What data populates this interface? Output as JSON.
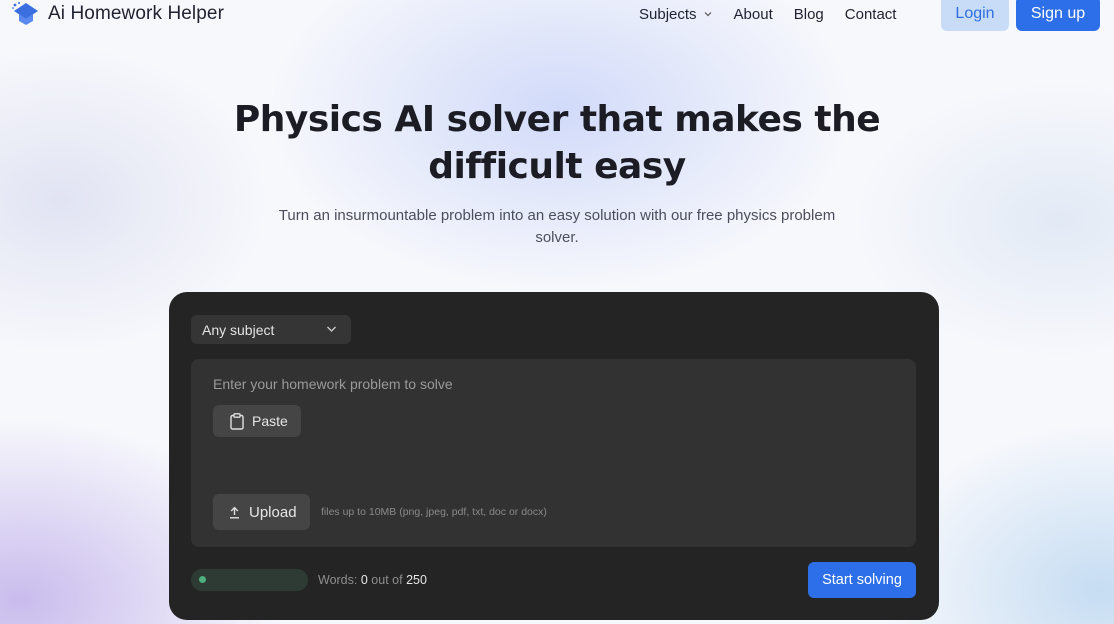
{
  "header": {
    "logo_text": "Ai Homework Helper",
    "nav": {
      "subjects": "Subjects",
      "about": "About",
      "blog": "Blog",
      "contact": "Contact"
    },
    "login_label": "Login",
    "signup_label": "Sign up"
  },
  "hero": {
    "title_line1": "Physics AI solver that makes the",
    "title_line2": "difficult easy",
    "subtitle_line1": "Turn an insurmountable problem into an easy solution with our free physics problem",
    "subtitle_line2": "solver."
  },
  "solver": {
    "subject_select": "Any subject",
    "input_placeholder": "Enter your homework problem to solve",
    "paste_label": "Paste",
    "upload_label": "Upload",
    "upload_hint": "files up to 10MB (png, jpeg, pdf, txt, doc or docx)",
    "word_count": {
      "prefix": "Words:",
      "current": "0",
      "middle": "out of",
      "max": "250"
    },
    "start_label": "Start solving"
  },
  "icons": {
    "logo": "graduation-cap-icon",
    "subjects_chevron": "chevron-down-icon",
    "select_chevron": "chevron-down-icon",
    "paste": "clipboard-icon",
    "upload": "upload-icon"
  },
  "colors": {
    "accent": "#2d6fe8",
    "login_bg": "#c9dcf7",
    "card_bg": "#242424",
    "progress_dot": "#4caf7d"
  }
}
